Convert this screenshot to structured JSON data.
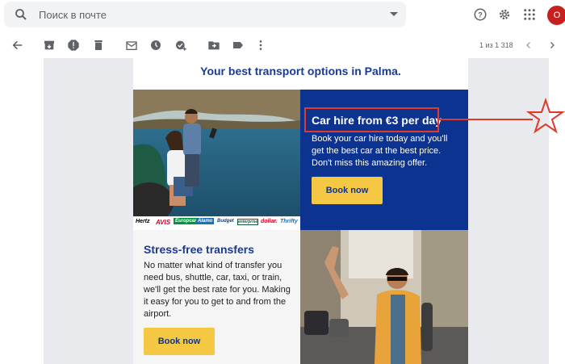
{
  "search": {
    "placeholder": "Поиск в почте"
  },
  "account": {
    "initial": "O"
  },
  "pager": {
    "text": "1 из 1 318"
  },
  "email": {
    "headline": "Your best transport options in Palma.",
    "car_hire": {
      "title": "Car hire from €3 per day",
      "body": "Book your car hire today and you'll get the best car at the best price. Don't miss this amazing offer.",
      "button": "Book now"
    },
    "transfers": {
      "title": "Stress-free transfers",
      "body": "No matter what kind of transfer you need bus, shuttle, car, taxi, or train, we'll get the best rate for you. Making it easy for you to get to and from the airport.",
      "button": "Book now"
    },
    "logos": [
      "Hertz",
      "AVIS",
      "Europcar",
      "Alamo",
      "Budget",
      "enterprise",
      "dollar.",
      "Thrifty"
    ]
  },
  "colors": {
    "navy": "#0d3390",
    "headline_blue": "#1a3a94",
    "button_yellow": "#f4c842",
    "annotation_red": "#e23a2a"
  }
}
